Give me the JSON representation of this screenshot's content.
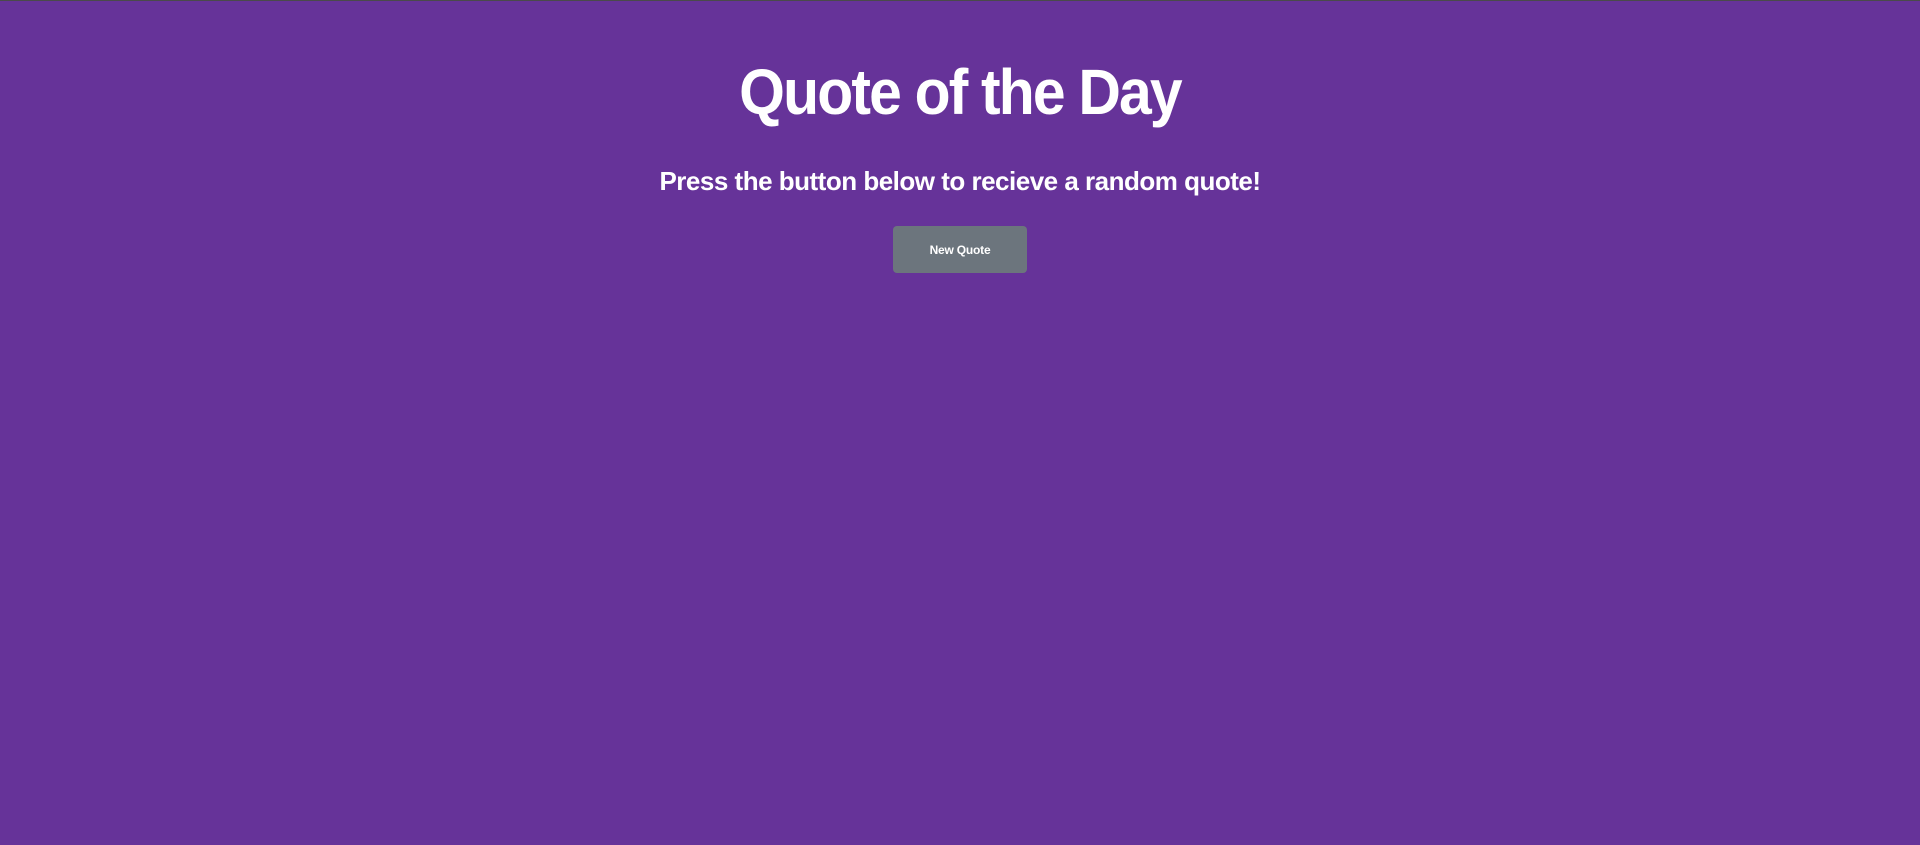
{
  "header": {
    "title": "Quote of the Day",
    "subtitle": "Press the button below to recieve a random quote!"
  },
  "actions": {
    "new_quote_label": "New Quote"
  },
  "colors": {
    "background": "#663399",
    "text": "#ffffff",
    "button": "#6c757d"
  }
}
